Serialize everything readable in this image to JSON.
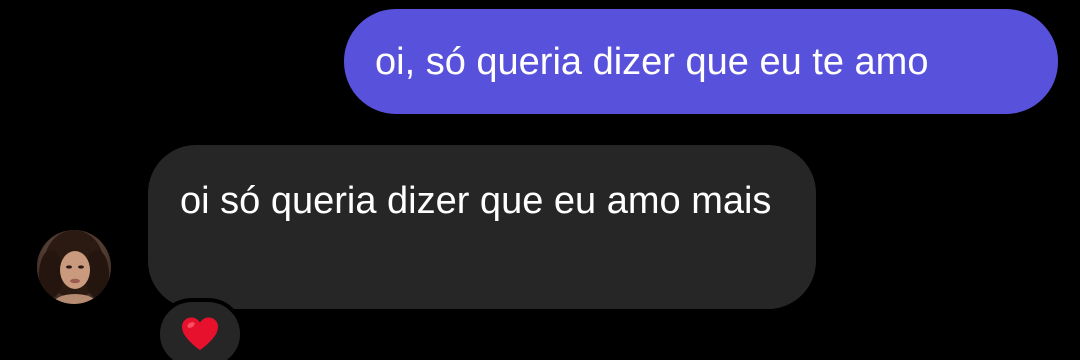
{
  "messages": {
    "sent": {
      "text": "oi, só queria dizer que eu te amo",
      "bubble_color": "#5851db"
    },
    "received": {
      "text": "oi só queria dizer que eu amo mais",
      "bubble_color": "#262626",
      "reaction_icon": "red-heart-icon"
    }
  },
  "theme": {
    "background": "#000000",
    "text_color": "#ffffff",
    "heart_color": "#e8112d"
  }
}
